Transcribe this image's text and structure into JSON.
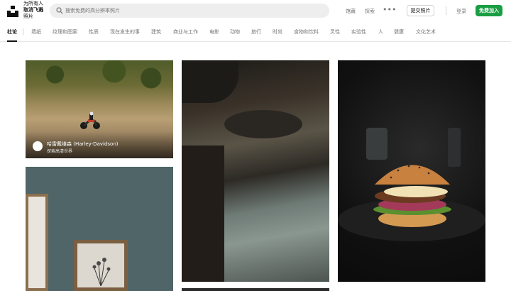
{
  "brand": {
    "line1": "为所有人",
    "line2": "取消飞溅",
    "line3": "照片"
  },
  "search": {
    "placeholder": "搜索免费的高分辨率照片"
  },
  "nav": {
    "links": [
      "馆藏",
      "探索"
    ],
    "more": "•••",
    "submit_label": "提交照片",
    "login": "登录",
    "join": "免费加入"
  },
  "categories": [
    "社论",
    "墙纸",
    "纹理和图案",
    "性质",
    "现在发生的事",
    "建筑",
    "商业与工作",
    "电影",
    "动物",
    "旅行",
    "时尚",
    "食物和饮料",
    "灵性",
    "实验性",
    "人",
    "健康",
    "文化艺术"
  ],
  "active_category": "社论",
  "photos": {
    "sponsor": {
      "name": "哈雷戴维森 (Harley-Davidson)",
      "subtitle": "探索高清世界"
    }
  },
  "colors": {
    "accent": "#1a9e44",
    "text": "#111111",
    "muted": "#767676"
  },
  "icons": {
    "logo": "unsplash-logo",
    "search": "search-icon"
  }
}
